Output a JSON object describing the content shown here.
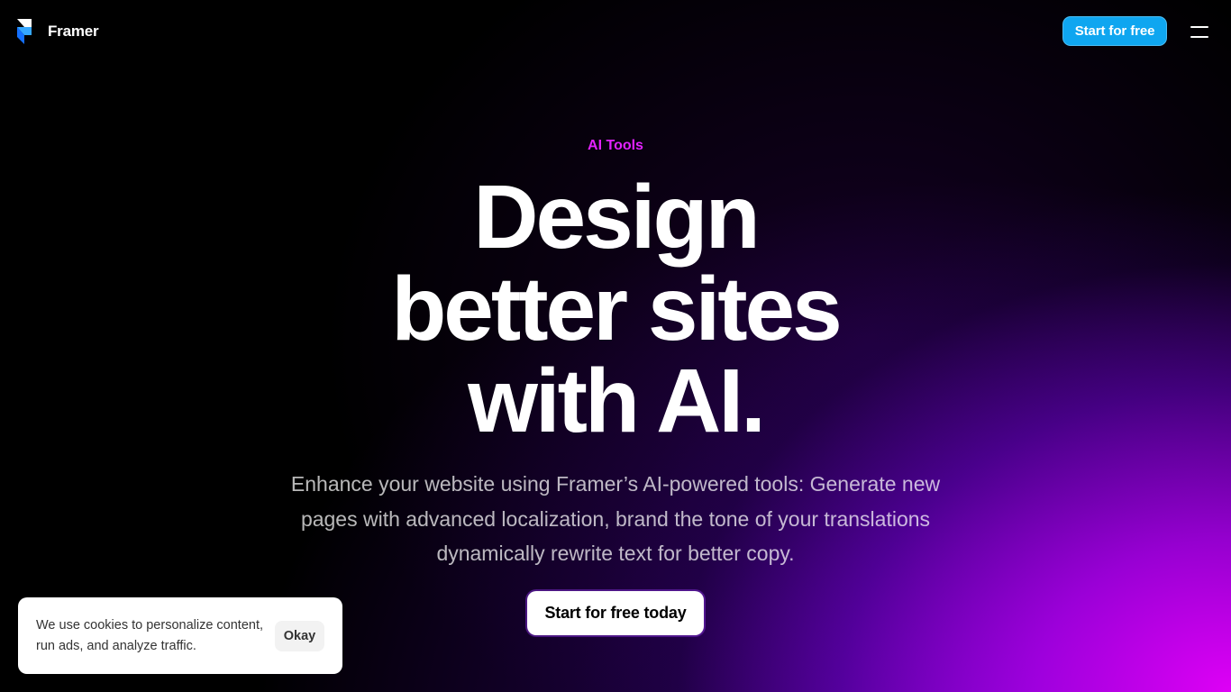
{
  "nav": {
    "brand": "Framer",
    "cta_label": "Start for free",
    "menu_icon": "hamburger-menu-icon"
  },
  "hero": {
    "eyebrow": "AI Tools",
    "headline_lines": [
      "Design",
      "better sites",
      "with AI."
    ],
    "subtitle": "Enhance your website using Framer’s AI-powered tools: Generate new pages with advanced localization, brand the tone of your translations dynamically rewrite text for better copy.",
    "cta_label": "Start for free today"
  },
  "cookie_banner": {
    "message": "We use cookies to personalize content, run ads, and analyze traffic.",
    "button_label": "Okay"
  },
  "colors": {
    "background": "#000000",
    "eyebrow": "#e222ff",
    "nav_cta": "#0fa6f0",
    "glow_primary": "#e800ff",
    "glow_secondary": "#8c00ff"
  }
}
